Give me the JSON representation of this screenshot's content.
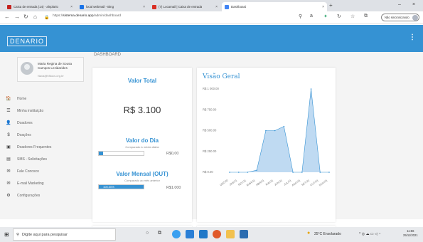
{
  "browser": {
    "tabs": [
      {
        "title": "Caixa de entrada (14) - alnplario",
        "favicon_color": "#c5221f",
        "x": 6,
        "w": 100
      },
      {
        "title": "local webmail - Bing",
        "favicon_color": "#1a73e8",
        "x": 108,
        "w": 100
      },
      {
        "title": "(7) Locamail | Caixa de entrada",
        "favicon_color": "#d93025",
        "x": 210,
        "w": 100
      },
      {
        "title": "Dashboard",
        "favicon_color": "#4285f4",
        "x": 312,
        "w": 148,
        "active": true
      }
    ],
    "new_tab": "+",
    "minimize": "–",
    "close": "×",
    "url_prefix": "https://",
    "url_host": "sistema.denario.app",
    "url_path": "/admin/dashboard",
    "sync_label": "Não sincronizando"
  },
  "app": {
    "logo": "DENARIO",
    "menu_icon": "⋮"
  },
  "profile": {
    "name": "Maria Regina de Sousa Campos Lezidarides",
    "email": "Nava@hfdocs.org.br"
  },
  "sidebar": {
    "items": [
      {
        "label": "Home",
        "icon": "🏠",
        "icon_name": "home-icon"
      },
      {
        "label": "Minha instituição",
        "icon": "☰",
        "icon_name": "institution-icon"
      },
      {
        "label": "Doadores",
        "icon": "👤",
        "icon_name": "user-icon"
      },
      {
        "label": "Doações",
        "icon": "$",
        "icon_name": "dollar-icon"
      },
      {
        "label": "Doadores Frequentes",
        "icon": "▣",
        "icon_name": "calendar-icon"
      },
      {
        "label": "SMS - Solicitações",
        "icon": "▤",
        "icon_name": "sms-icon"
      },
      {
        "label": "Fale Conosco",
        "icon": "✉",
        "icon_name": "mail-icon"
      },
      {
        "label": "E-mail Marketing",
        "icon": "✉",
        "icon_name": "email-marketing-icon"
      },
      {
        "label": "Configurações",
        "icon": "⚙",
        "icon_name": "gear-icon"
      }
    ]
  },
  "main": {
    "breadcrumb": "DASHBOARD",
    "valor_total": {
      "title": "Valor Total",
      "value": "R$ 3.100"
    },
    "valor_dia": {
      "title": "Valor do Dia",
      "sub": "Comparado à média diária",
      "amount": "R$0,00",
      "progress": 0
    },
    "valor_mensal": {
      "title": "Valor Mensal (OUT)",
      "sub": "Comparado ao mês anterior",
      "percent_label": "100.00%",
      "amount": "R$1.000",
      "progress": 1.0
    }
  },
  "chart_data": {
    "type": "area",
    "title": "Visão Geral",
    "categories": [
      "DEZ/20",
      "JAN/21",
      "FEV/21",
      "MAR/21",
      "ABR/21",
      "MAI/21",
      "JUN/21",
      "JUL/21",
      "AGO/21",
      "SET/21",
      "OUT/21",
      "NOV/21"
    ],
    "values": [
      0,
      0,
      0,
      50,
      1000,
      1000,
      1100,
      0,
      0,
      2000,
      0,
      0
    ],
    "ytick_labels": [
      "R$ 1 000.00",
      "R$ 750.00",
      "R$ 500.00",
      "R$ 250.00",
      "R$ 0.00"
    ],
    "ylim": [
      0,
      2000
    ],
    "fill_color": "#a9cdee",
    "line_color": "#3592d3"
  },
  "taskbar": {
    "search_placeholder": "Digite aqui para pesquisar",
    "weather": "25°C  Ensolarado",
    "time": "11:56",
    "date": "25/11/2021"
  }
}
